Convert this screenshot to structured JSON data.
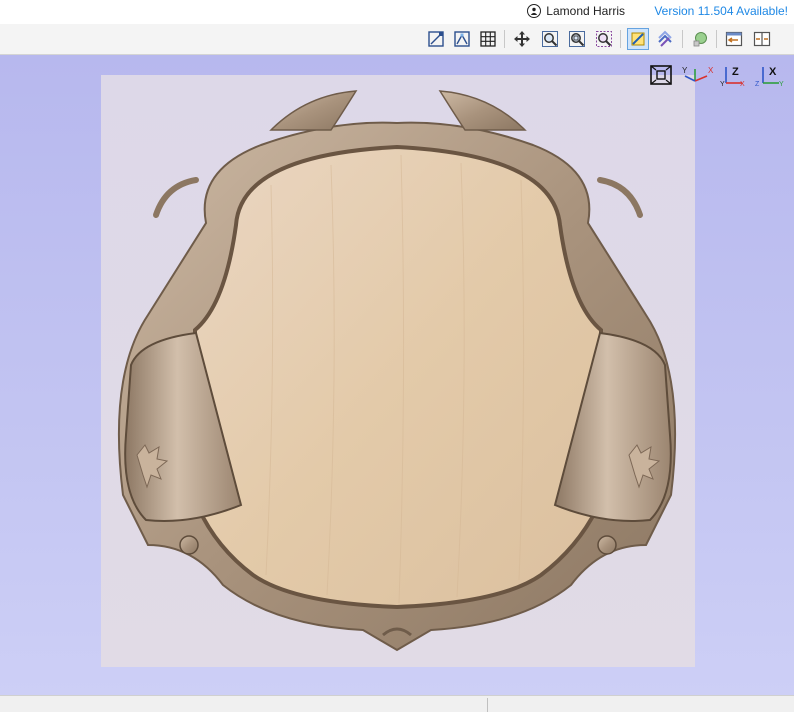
{
  "header": {
    "user_name": "Lamond Harris",
    "version_notice": "Version 11.504 Available!"
  },
  "toolbar": {
    "buttons": [
      {
        "name": "select-transform-icon"
      },
      {
        "name": "node-edit-icon"
      },
      {
        "name": "grid-icon"
      },
      {
        "name": "pan-icon"
      },
      {
        "name": "zoom-box-icon"
      },
      {
        "name": "zoom-fit-icon"
      },
      {
        "name": "zoom-selected-icon"
      },
      {
        "name": "view-mode-icon",
        "active": true
      },
      {
        "name": "layer-toggle-icon"
      },
      {
        "name": "render-3d-icon"
      },
      {
        "name": "split-view-left-icon"
      },
      {
        "name": "split-view-right-icon"
      }
    ]
  },
  "view_controls": {
    "axis_labels": [
      "Y",
      "X",
      "Z",
      "X",
      "Y",
      "Z",
      "X",
      "Y"
    ]
  },
  "colors": {
    "accent": "#1e88e5",
    "viewport_bg": "#bfc1f2",
    "wood": "#e5cdb6",
    "frame": "#b8a38e"
  }
}
